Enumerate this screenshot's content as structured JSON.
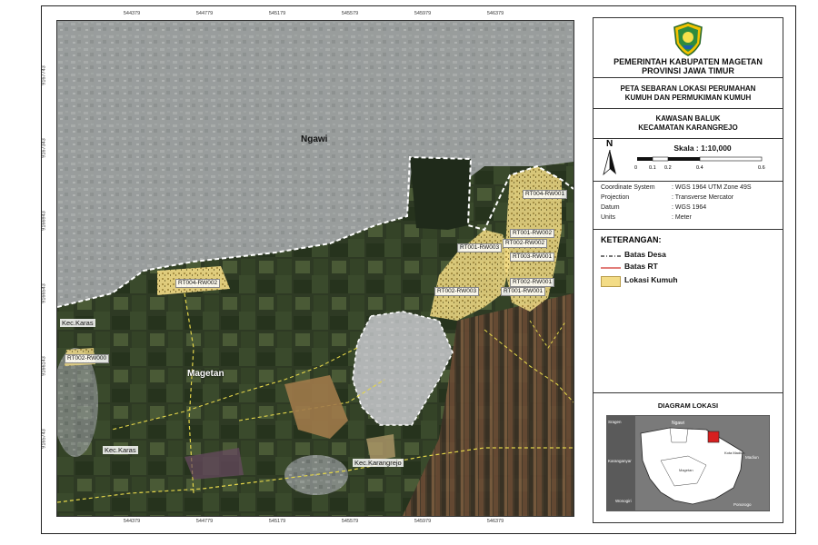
{
  "grid": {
    "top_ticks": [
      "544379",
      "544779",
      "545179",
      "545579",
      "545979",
      "546379"
    ],
    "left_ticks": [
      "9167743",
      "9167343",
      "9166943",
      "9166543",
      "9166143",
      "9165743"
    ],
    "right_ticks": [
      "9167743",
      "9167343",
      "9166943",
      "9166543",
      "9166143",
      "9165743"
    ]
  },
  "map_labels": {
    "ngawi": "Ngawi",
    "magetan": "Magetan",
    "kec_karas_1": "Kec.Karas",
    "kec_karas_2": "Kec.Karas",
    "kec_karangrejo": "Kec.Karangrejo"
  },
  "rt_labels": {
    "rt004_rw001": "RT004-RW001",
    "rt001_rw003": "RT001-RW003",
    "rt001_rw002": "RT001-RW002",
    "rt002_rw002": "RT002-RW002",
    "rt003_rw001": "RT003-RW001",
    "rt002_rw003": "RT002-RW003",
    "rt002_rw001": "RT002-RW001",
    "rt001_rw001": "RT001-RW001",
    "rt004_rw002": "RT004-RW002",
    "rt002_rw000": "RT002-RW000"
  },
  "panel": {
    "header_line1": "PEMERINTAH KABUPATEN MAGETAN",
    "header_line2": "PROVINSI JAWA TIMUR",
    "title_line1": "PETA SEBARAN LOKASI PERUMAHAN",
    "title_line2": "KUMUH DAN PERMUKIMAN KUMUH",
    "area_line1": "KAWASAN BALUK",
    "area_line2": "KECAMATAN KARANGREJO",
    "north": "N",
    "scale_label": "Skala : 1:10,000",
    "scale_ticks": [
      "0",
      "0.1",
      "0.2",
      "0.4",
      "0.6"
    ],
    "info": [
      {
        "label": "Coordinate System",
        "value": ": WGS 1964 UTM Zone 49S"
      },
      {
        "label": "Projection",
        "value": ": Transverse Mercator"
      },
      {
        "label": "Datum",
        "value": ": WGS 1964"
      },
      {
        "label": "Units",
        "value": ": Meter"
      }
    ],
    "legend_title": "KETERANGAN:",
    "legend": {
      "batas_desa": "Batas Desa",
      "batas_rt": "Batas RT",
      "lokasi_kumuh": "Lokasi Kumuh"
    },
    "diagram_title": "DIAGRAM LOKASI",
    "diagram_labels": {
      "ngawi": "Ngawi",
      "karanganyar": "Karanganyar",
      "wonogiri": "Wonogiri",
      "madiun": "Madiun",
      "kota_madiun": "Kota Madiun",
      "ponorogo": "Ponorogo",
      "sragen": "Sragen",
      "magetan": "Magetan"
    }
  },
  "colors": {
    "slum": "#f3dc86",
    "rt_boundary": "#d9534f",
    "village_boundary": "#222222",
    "highlight": "#d61f1f"
  }
}
